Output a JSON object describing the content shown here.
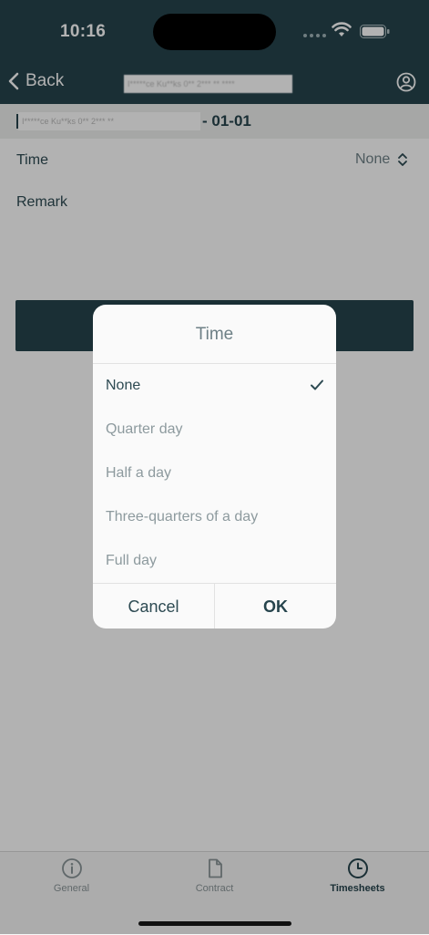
{
  "status_bar": {
    "time": "10:16"
  },
  "navbar": {
    "back_label": "Back",
    "title": "I*****ce Ku**ks 0** 2*** ** ****"
  },
  "header": {
    "blurred_text": "I*****ce Ku**ks 0** 2*** **",
    "suffix": "- 01-01"
  },
  "form": {
    "time_label": "Time",
    "time_value": "None",
    "remark_label": "Remark"
  },
  "dialog": {
    "title": "Time",
    "options": [
      {
        "label": "None",
        "selected": true
      },
      {
        "label": "Quarter day",
        "selected": false
      },
      {
        "label": "Half a day",
        "selected": false
      },
      {
        "label": "Three-quarters of a day",
        "selected": false
      },
      {
        "label": "Full day",
        "selected": false
      }
    ],
    "cancel_label": "Cancel",
    "ok_label": "OK"
  },
  "tabbar": {
    "tabs": [
      {
        "label": "General",
        "icon": "info-circle-icon",
        "active": false
      },
      {
        "label": "Contract",
        "icon": "document-icon",
        "active": false
      },
      {
        "label": "Timesheets",
        "icon": "clock-icon",
        "active": true
      }
    ]
  },
  "colors": {
    "primary": "#26444d",
    "muted": "#8d9a9e"
  }
}
